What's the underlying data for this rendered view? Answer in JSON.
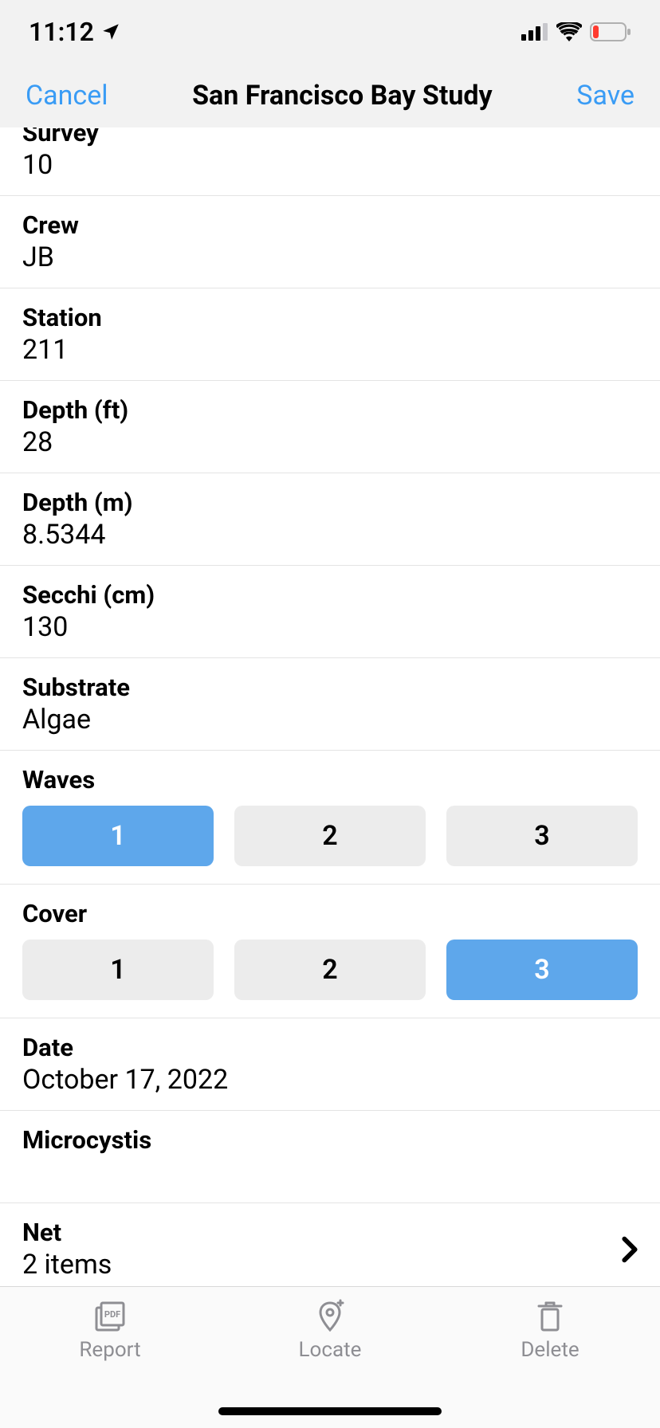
{
  "status": {
    "time": "11:12"
  },
  "nav": {
    "cancel": "Cancel",
    "title": "San Francisco Bay Study",
    "save": "Save"
  },
  "fields": {
    "survey": {
      "label": "Survey",
      "value": "10"
    },
    "crew": {
      "label": "Crew",
      "value": "JB"
    },
    "station": {
      "label": "Station",
      "value": "211"
    },
    "depth_ft": {
      "label": "Depth (ft)",
      "value": "28"
    },
    "depth_m": {
      "label": "Depth (m)",
      "value": "8.5344"
    },
    "secchi": {
      "label": "Secchi (cm)",
      "value": "130"
    },
    "substrate": {
      "label": "Substrate",
      "value": "Algae"
    },
    "waves": {
      "label": "Waves",
      "options": [
        "1",
        "2",
        "3"
      ],
      "selected": "1"
    },
    "cover": {
      "label": "Cover",
      "options": [
        "1",
        "2",
        "3"
      ],
      "selected": "3"
    },
    "date": {
      "label": "Date",
      "value": "October 17, 2022"
    },
    "microcystis": {
      "label": "Microcystis",
      "value": ""
    },
    "net": {
      "label": "Net",
      "value": "2 items"
    }
  },
  "tabs": {
    "report": "Report",
    "locate": "Locate",
    "delete": "Delete"
  }
}
